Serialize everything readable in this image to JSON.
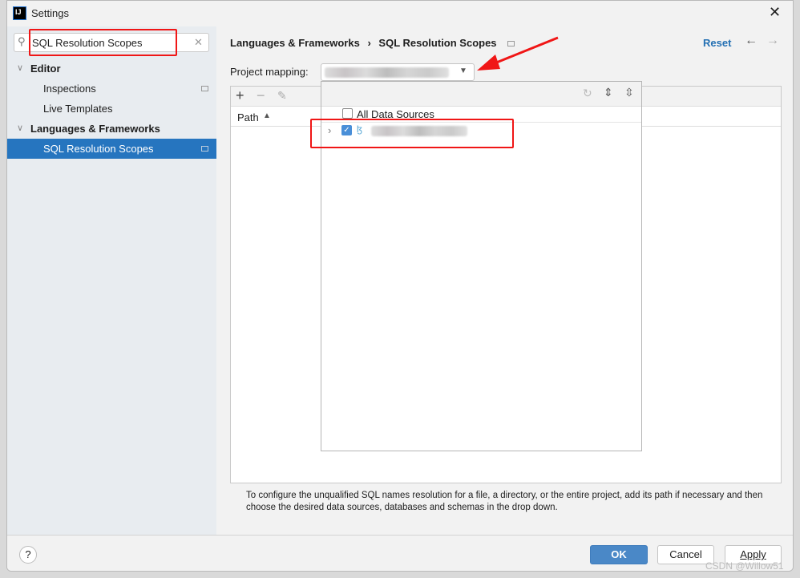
{
  "window": {
    "title": "Settings",
    "app_icon": "intellij-icon",
    "close_icon": "close-icon"
  },
  "search": {
    "value": "SQL Resolution Scopes",
    "clear_icon": "clear-icon"
  },
  "sidebar": {
    "items": [
      {
        "label": "Editor",
        "level": 0,
        "expanded": true
      },
      {
        "label": "Inspections",
        "level": 1
      },
      {
        "label": "Live Templates",
        "level": 1
      },
      {
        "label": "Languages & Frameworks",
        "level": 0,
        "expanded": true
      },
      {
        "label": "SQL Resolution Scopes",
        "level": 1,
        "selected": true
      }
    ]
  },
  "breadcrumb": {
    "parent": "Languages & Frameworks",
    "separator": "›",
    "current": "SQL Resolution Scopes"
  },
  "header": {
    "reset": "Reset"
  },
  "mapping": {
    "label": "Project mapping:"
  },
  "table": {
    "columns": [
      "Path"
    ],
    "sort": "ascending"
  },
  "popup": {
    "items": [
      {
        "label": "All Data Sources",
        "checked": false
      },
      {
        "label": "",
        "checked": true,
        "icon": "mysql-icon"
      }
    ]
  },
  "description": "To configure the unqualified SQL names resolution for a file, a directory, or the entire project, add its path if necessary and then choose the desired data sources, databases and schemas in the drop down.",
  "footer": {
    "help": "?",
    "ok": "OK",
    "cancel": "Cancel",
    "apply": "Apply"
  },
  "watermark": "CSDN @Willow51",
  "colors": {
    "accent": "#2675bf",
    "ok_button": "#4a88c7",
    "annotation": "#f01616",
    "link": "#2470b3"
  }
}
